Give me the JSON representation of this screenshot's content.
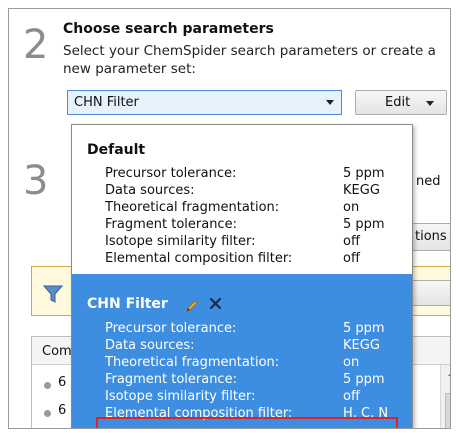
{
  "step2": {
    "number": "2",
    "title": "Choose search parameters",
    "subtitle": "Select your ChemSpider search parameters or create a new parameter set:"
  },
  "step3": {
    "number": "3"
  },
  "combo": {
    "selected": "CHN Filter"
  },
  "edit_button": {
    "label": "Edit"
  },
  "background": {
    "partial_text": "ned",
    "partial_button": "tions",
    "table_header_partial": "Com",
    "row_partials": [
      "6",
      "6"
    ]
  },
  "dropdown": {
    "groups": [
      {
        "name": "Default",
        "params": [
          {
            "label": "Precursor tolerance:",
            "value": "5 ppm"
          },
          {
            "label": "Data sources:",
            "value": "KEGG"
          },
          {
            "label": "Theoretical fragmentation:",
            "value": "on"
          },
          {
            "label": "Fragment tolerance:",
            "value": "5 ppm"
          },
          {
            "label": "Isotope similarity filter:",
            "value": "off"
          },
          {
            "label": "Elemental composition filter:",
            "value": "off"
          }
        ]
      },
      {
        "name": "CHN Filter",
        "selected": true,
        "params": [
          {
            "label": "Precursor tolerance:",
            "value": "5 ppm"
          },
          {
            "label": "Data sources:",
            "value": "KEGG"
          },
          {
            "label": "Theoretical fragmentation:",
            "value": "on"
          },
          {
            "label": "Fragment tolerance:",
            "value": "5 ppm"
          },
          {
            "label": "Isotope similarity filter:",
            "value": "off"
          },
          {
            "label": "Elemental composition filter:",
            "value": "H, C, N"
          }
        ]
      }
    ]
  },
  "colors": {
    "selection_blue": "#3d8ee0",
    "highlight_red": "#e0202a",
    "pencil_orange": "#e8a020"
  },
  "icons": [
    "pencil-icon",
    "close-icon",
    "funnel-icon",
    "dropdown-arrow-icon"
  ]
}
